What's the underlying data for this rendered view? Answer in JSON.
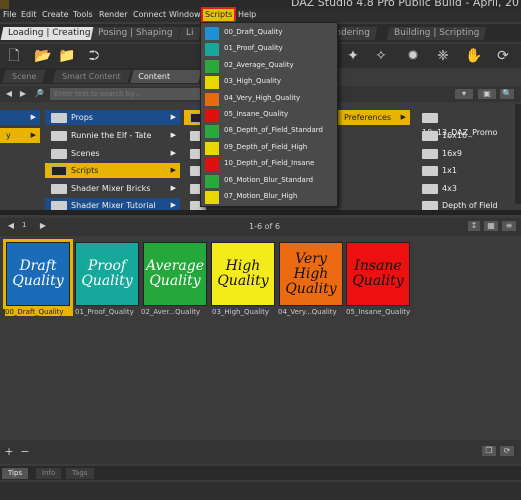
{
  "app": {
    "title": "DAZ Studio 4.8 Pro Public Build - April, 20"
  },
  "menubar": {
    "items": [
      "File",
      "Edit",
      "Create",
      "Tools",
      "Render",
      "Connect",
      "Window",
      "Scripts",
      "Help"
    ],
    "active": "Scripts"
  },
  "layout_tabs": [
    "Loading | Creating",
    "Posing | Shaping",
    "Li",
    "Rendering",
    "Building | Scripting"
  ],
  "panel_tabs": [
    "Scene",
    "Smart Content",
    "Content Library"
  ],
  "search": {
    "placeholder": "Enter text to search by..."
  },
  "tree_left": [
    {
      "label": "",
      "style": "blue"
    },
    {
      "label": "y",
      "style": "yellow"
    }
  ],
  "tree_mid": [
    {
      "label": "Props",
      "style": "blue"
    },
    {
      "label": "Runnie the Elf - Tate",
      "style": "none"
    },
    {
      "label": "Scenes",
      "style": "none"
    },
    {
      "label": "Scripts",
      "style": "yellow"
    },
    {
      "label": "Shader Mixer Bricks",
      "style": "none"
    },
    {
      "label": "Shader Mixer Tutorial",
      "style": "blue"
    }
  ],
  "tree_right": [
    {
      "label": "Preferences",
      "style": "yellow"
    }
  ],
  "tree_far_right": [
    "10x13_DAZ_Promo",
    "16x10",
    "16x9",
    "1x1",
    "4x3",
    "Depth of Field"
  ],
  "scripts_menu": [
    {
      "label": "00_Draft_Quality",
      "color": "#1f8fd6"
    },
    {
      "label": "01_Proof_Quality",
      "color": "#16a89a"
    },
    {
      "label": "02_Average_Quality",
      "color": "#2aa83a"
    },
    {
      "label": "03_High_Quality",
      "color": "#e8d800"
    },
    {
      "label": "04_Very_High_Quality",
      "color": "#e86a10"
    },
    {
      "label": "05_Insane_Quality",
      "color": "#e01010"
    },
    {
      "label": "08_Depth_of_Field_Standard",
      "color": "#2aa83a"
    },
    {
      "label": "09_Depth_of_Field_High",
      "color": "#e8d800"
    },
    {
      "label": "10_Depth_of_Field_Insane",
      "color": "#e01010"
    },
    {
      "label": "06_Motion_Blur_Standard",
      "color": "#2aa83a"
    },
    {
      "label": "07_Motion_Blur_High",
      "color": "#e8d800"
    }
  ],
  "content": {
    "page": "1",
    "count_label": "1-6 of 6"
  },
  "thumbnails": [
    {
      "text_line1": "Draft",
      "text_line2": "Quality",
      "text_line3": "",
      "bg": "#1a6bb8",
      "fg": "#ffffff",
      "caption": "00_Draft_Quality"
    },
    {
      "text_line1": "Proof",
      "text_line2": "Quality",
      "text_line3": "",
      "bg": "#16a89a",
      "fg": "#ffffff",
      "caption": "01_Proof_Quality"
    },
    {
      "text_line1": "Average",
      "text_line2": "Quality",
      "text_line3": "",
      "bg": "#24a83c",
      "fg": "#ffffff",
      "caption": "02_Aver...Quality"
    },
    {
      "text_line1": "High",
      "text_line2": "Quality",
      "text_line3": "",
      "bg": "#f4ec1a",
      "fg": "#111111",
      "caption": "03_High_Quality"
    },
    {
      "text_line1": "Very",
      "text_line2": "High",
      "text_line3": "Quality",
      "bg": "#ec6a12",
      "fg": "#111111",
      "caption": "04_Very...Quality"
    },
    {
      "text_line1": "Insane",
      "text_line2": "Quality",
      "text_line3": "",
      "bg": "#ec1010",
      "fg": "#111111",
      "caption": "05_Insane_Quality"
    }
  ],
  "bottom_tabs": [
    "Tips",
    "Info",
    "Tags"
  ],
  "colors": {
    "accent": "#e8b400",
    "highlight_blue": "#1b4c8c"
  }
}
